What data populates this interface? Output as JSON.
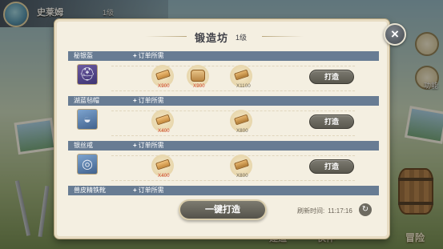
{
  "player": {
    "name": "史莱姆",
    "level": "1级"
  },
  "side_menu": {
    "label": "功能"
  },
  "bottom_nav": [
    {
      "label": "建造"
    },
    {
      "label": "伙伴"
    },
    {
      "label": "冒险"
    }
  ],
  "forge": {
    "title": "锻造坊",
    "level": "1级",
    "close_icon": "×",
    "requirement_label": "订单所需",
    "forge_label": "打造",
    "oneclick_label": "一键打造",
    "refresh_label": "刷新时间:",
    "refresh_time": "11:17:16",
    "refresh_icon": "↻",
    "recipes": [
      {
        "name": "秘银盔",
        "item_icon": "helmet-icon",
        "materials": [
          {
            "icon": "ingot-icon",
            "count": "X900",
            "sufficient": false
          },
          {
            "icon": "cloth-icon",
            "count": "X900",
            "sufficient": false
          },
          {
            "icon": "plank-icon",
            "count": "X1100",
            "sufficient": true
          }
        ]
      },
      {
        "name": "湖蓝毡帽",
        "item_icon": "hat-icon",
        "materials": [
          {
            "icon": "ingot-icon",
            "count": "X400",
            "sufficient": false
          },
          {
            "icon": "plank-icon",
            "count": "X800",
            "sufficient": true
          }
        ]
      },
      {
        "name": "银丝戒",
        "item_icon": "ring-icon",
        "materials": [
          {
            "icon": "ingot-icon",
            "count": "X400",
            "sufficient": false
          },
          {
            "icon": "plank-icon",
            "count": "X800",
            "sufficient": true
          }
        ]
      },
      {
        "name": "兽皮精铁靴",
        "item_icon": "boots-icon",
        "materials": []
      }
    ]
  },
  "colors": {
    "header_bar": "#687c93",
    "panel_bg": "#f4efe1",
    "insufficient": "#d2412f",
    "button": "#5a584f"
  }
}
